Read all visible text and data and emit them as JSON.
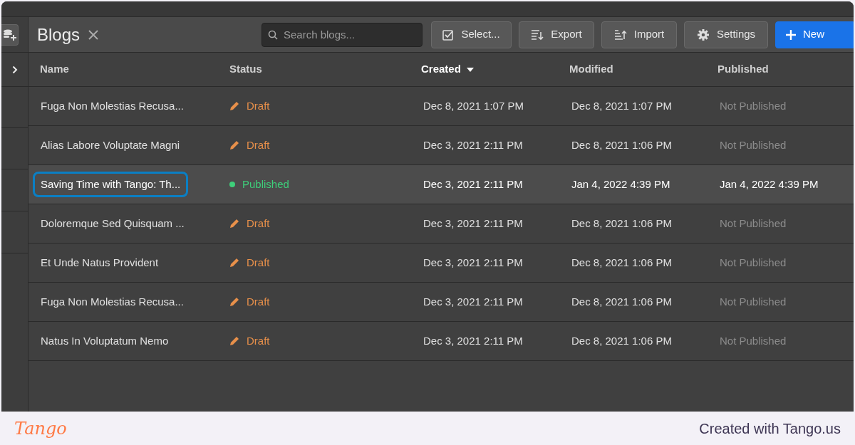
{
  "header": {
    "title": "Blogs",
    "search": {
      "placeholder": "Search blogs..."
    },
    "buttons": [
      {
        "label": "Select...",
        "kind": "select"
      },
      {
        "label": "Export",
        "kind": "export"
      },
      {
        "label": "Import",
        "kind": "import"
      },
      {
        "label": "Settings",
        "kind": "settings"
      },
      {
        "label": "New",
        "kind": "new"
      }
    ]
  },
  "table": {
    "columns": [
      {
        "label": "Name",
        "sorted": false
      },
      {
        "label": "Status",
        "sorted": false
      },
      {
        "label": "Created",
        "sorted": true
      },
      {
        "label": "Modified",
        "sorted": false
      },
      {
        "label": "Published",
        "sorted": false
      }
    ],
    "rows": [
      {
        "name": "Fuga Non Molestias Recusa...",
        "status": "Draft",
        "kind": "draft",
        "created": "Dec 8, 2021 1:07 PM",
        "modified": "Dec 8, 2021 1:07 PM",
        "published": "Not Published",
        "selected": false
      },
      {
        "name": "Alias Labore Voluptate Magni",
        "status": "Draft",
        "kind": "draft",
        "created": "Dec 3, 2021 2:11 PM",
        "modified": "Dec 8, 2021 1:06 PM",
        "published": "Not Published",
        "selected": false
      },
      {
        "name": "Saving Time with Tango: Th...",
        "status": "Published",
        "kind": "published",
        "created": "Dec 3, 2021 2:11 PM",
        "modified": "Jan 4, 2022 4:39 PM",
        "published": "Jan 4, 2022 4:39 PM",
        "selected": true
      },
      {
        "name": "Doloremque Sed Quisquam ...",
        "status": "Draft",
        "kind": "draft",
        "created": "Dec 3, 2021 2:11 PM",
        "modified": "Dec 8, 2021 1:06 PM",
        "published": "Not Published",
        "selected": false
      },
      {
        "name": "Et Unde Natus Provident",
        "status": "Draft",
        "kind": "draft",
        "created": "Dec 3, 2021 2:11 PM",
        "modified": "Dec 8, 2021 1:06 PM",
        "published": "Not Published",
        "selected": false
      },
      {
        "name": "Fuga Non Molestias Recusa...",
        "status": "Draft",
        "kind": "draft",
        "created": "Dec 3, 2021 2:11 PM",
        "modified": "Dec 8, 2021 1:06 PM",
        "published": "Not Published",
        "selected": false
      },
      {
        "name": "Natus In Voluptatum Nemo",
        "status": "Draft",
        "kind": "draft",
        "created": "Dec 3, 2021 2:11 PM",
        "modified": "Dec 8, 2021 1:06 PM",
        "published": "Not Published",
        "selected": false
      }
    ]
  },
  "footer": {
    "logo": "Tango",
    "text": "Created with Tango.us"
  }
}
